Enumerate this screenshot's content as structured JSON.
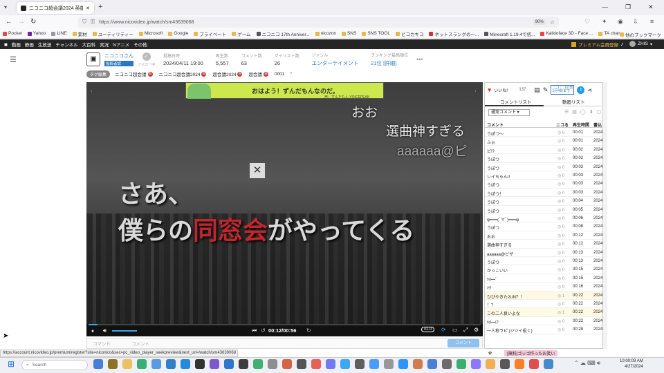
{
  "browser": {
    "tab_title": "ニコニコ超会議2024 英雄的音…",
    "new_tab_icon": "+",
    "url": "https://www.nicovideo.jp/watch/sm43639068",
    "zoom": "90%",
    "window_controls": [
      "—",
      "❐",
      "✕"
    ]
  },
  "bookmarks": [
    {
      "label": "Pocket",
      "color": "#e44"
    },
    {
      "label": "Yahoo",
      "color": "#7b1fa2"
    },
    {
      "label": "LINE",
      "color": "#999"
    },
    {
      "label": "素材",
      "color": "#e9b949"
    },
    {
      "label": "ユーティリティー",
      "color": "#e9b949"
    },
    {
      "label": "Microsoft",
      "color": "#e9b949"
    },
    {
      "label": "Google",
      "color": "#e9b949"
    },
    {
      "label": "プライベート",
      "color": "#e9b949"
    },
    {
      "label": "ゲーム",
      "color": "#e9b949"
    },
    {
      "label": "ニコニコ 17th Anniver...",
      "color": "#555"
    },
    {
      "label": "nicozon",
      "color": "#e9b949"
    },
    {
      "label": "SNS",
      "color": "#e9b949"
    },
    {
      "label": "SNS TOOL",
      "color": "#e9b949"
    },
    {
      "label": "ビコカキコ",
      "color": "#e9b949"
    },
    {
      "label": "ネットスラングの一...",
      "color": "#c33"
    },
    {
      "label": "Minecraft 1.19.4で初...",
      "color": "#555"
    },
    {
      "label": "Kalidoface 3D - Face ...",
      "color": "#e44"
    },
    {
      "label": "TA channel",
      "color": "#e9b949"
    }
  ],
  "bookmarks_other": "他のブックマーク",
  "nico_header": {
    "links": [
      "動画",
      "静画",
      "生放送",
      "チャンネル",
      "大百科",
      "実況",
      "Nアニメ",
      "その他"
    ],
    "premium": "プレミアム会員登録",
    "user": "ZHIS"
  },
  "video_info": {
    "owner": "ニコニコさん",
    "owner_badge": "投稿者認",
    "follow": "フォロー中",
    "stats": [
      {
        "label": "投稿日時",
        "value": "2024/04/11 19:00"
      },
      {
        "label": "再生数",
        "value": "5,557"
      },
      {
        "label": "コメント数",
        "value": "63"
      },
      {
        "label": "マイリスト数",
        "value": "26"
      },
      {
        "label": "ジャンル",
        "value": "エンターテイメント"
      },
      {
        "label": "ランキング最高順位",
        "value": "21位 [詳細]"
      }
    ],
    "more": "•••"
  },
  "tags": {
    "edit_label": "タグ編集",
    "items": [
      "ニコニコ超会議",
      "ニコニコ超会議2024",
      "超会議2024",
      "超会議",
      "0001"
    ]
  },
  "player": {
    "ad_text": "おはよう！ずんだもんなのだ。",
    "ad_sub": "声：ずんだもん VOICEPEAK",
    "floating_comments": [
      {
        "text": "おお"
      },
      {
        "text": "選曲神すぎる"
      },
      {
        "text": "aaaaaa@ピ"
      }
    ],
    "telop1": "さあ、",
    "telop2a": "僕らの",
    "telop2b": "同窓会",
    "telop2c": "がやってくる",
    "time": "00:12/00:56",
    "speed": "x1.0",
    "progress": 0.21
  },
  "comment_input": {
    "placeholder1": "コマンド",
    "placeholder2": "コメント",
    "submit": "コメント"
  },
  "side": {
    "like": "いいね！",
    "like_count": "137",
    "time_badge": "ニコニコ広告 1月4日まで",
    "tabs": [
      "コメントリスト",
      "動画リスト"
    ],
    "sort": "通常コメント",
    "columns": [
      "コメント",
      "ニコる",
      "再生時間",
      "書込"
    ],
    "rows": [
      {
        "c": "うぽつ～",
        "n": "0",
        "t": "00:01",
        "d": "2024"
      },
      {
        "c": "ふぉ",
        "n": "0",
        "t": "00:01",
        "d": "2024"
      },
      {
        "c": "ピ!?",
        "n": "0",
        "t": "00:02",
        "d": "2024"
      },
      {
        "c": "うぽつ",
        "n": "0",
        "t": "00:02",
        "d": "2024"
      },
      {
        "c": "うぽつ",
        "n": "0",
        "t": "00:03",
        "d": "2024"
      },
      {
        "c": "レイちゃん!!",
        "n": "0",
        "t": "00:03",
        "d": "2024"
      },
      {
        "c": "うぽつ",
        "n": "0",
        "t": "00:03",
        "d": "2024"
      },
      {
        "c": "うぽつ！",
        "n": "0",
        "t": "00:03",
        "d": "2024"
      },
      {
        "c": "うぽつ",
        "n": "0",
        "t": "00:04",
        "d": "2024"
      },
      {
        "c": "うぽつ",
        "n": "0",
        "t": "00:05",
        "d": "2024"
      },
      {
        "c": "ψ━━━(ﾟ∀ﾟ)━━━ψ",
        "n": "0",
        "t": "00:06",
        "d": "2024"
      },
      {
        "c": "うぽつ",
        "n": "0",
        "t": "00:08",
        "d": "2024"
      },
      {
        "c": "おお",
        "n": "0",
        "t": "00:12",
        "d": "2024"
      },
      {
        "c": "選曲神すぎる",
        "n": "0",
        "t": "00:12",
        "d": "2024"
      },
      {
        "c": "aaaaaa@ピザ",
        "n": "0",
        "t": "00:13",
        "d": "2024"
      },
      {
        "c": "うぽつ",
        "n": "0",
        "t": "00:13",
        "d": "2024"
      },
      {
        "c": "かっこいい",
        "n": "0",
        "t": "00:15",
        "d": "2024"
      },
      {
        "c": "ｷﾀ━ﾞ",
        "n": "0",
        "t": "00:15",
        "d": "2024"
      },
      {
        "c": "ｷﾀ",
        "n": "0",
        "t": "00:16",
        "d": "2024"
      },
      {
        "c": "ひびやきた2UN？！",
        "n": "1",
        "t": "00:22",
        "d": "2024",
        "hl": true
      },
      {
        "c": "！？",
        "n": "0",
        "t": "00:22",
        "d": "2024"
      },
      {
        "c": "この二人良いよな",
        "n": "1",
        "t": "00:22",
        "d": "2024",
        "hl": true
      },
      {
        "c": "ｷﾀ━!？",
        "n": "0",
        "t": "00:22",
        "d": "2024"
      },
      {
        "c": "一人称ラピ (ジジイ役く)",
        "n": "0",
        "t": "00:28",
        "d": "2024"
      }
    ],
    "bottom_banner": "[無料]ゴッゴ作ったお笑い"
  },
  "status_url": "https://account.nicovideo.jp/premium/register?site=niconico&sec=pc_video_player_seekpreview&next_url=/watch/sm43639068",
  "taskbar": {
    "search": "Search",
    "time": "10:00:09 AM",
    "date": "4/27/2024"
  }
}
